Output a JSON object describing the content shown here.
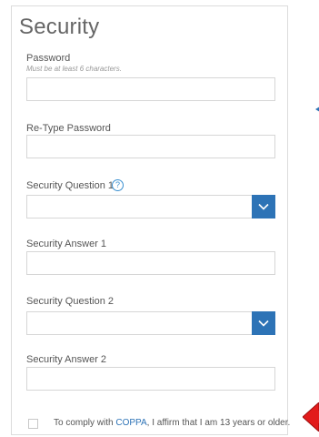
{
  "security": {
    "title": "Security",
    "password": {
      "label": "Password",
      "hint": "Must be at least 6 characters.",
      "value": "",
      "placeholder": ""
    },
    "retype_password": {
      "label": "Re-Type Password",
      "value": "",
      "placeholder": ""
    },
    "question1": {
      "label": "Security Question 1",
      "help_glyph": "?",
      "selected": ""
    },
    "answer1": {
      "label": "Security Answer 1",
      "value": "",
      "placeholder": ""
    },
    "question2": {
      "label": "Security Question 2",
      "selected": ""
    },
    "answer2": {
      "label": "Security Answer 2",
      "value": "",
      "placeholder": ""
    },
    "coppa": {
      "prefix": "To comply with ",
      "link": "COPPA",
      "suffix": ", I affirm that I am 13 years or older.",
      "checked": false
    }
  },
  "colors": {
    "accent": "#2d73b6",
    "annotation_arrow": "#e21b1b"
  },
  "icons": {
    "dropdown": "chevron-down-icon",
    "help": "question-circle-icon",
    "annotation": "red-arrow-icon"
  }
}
